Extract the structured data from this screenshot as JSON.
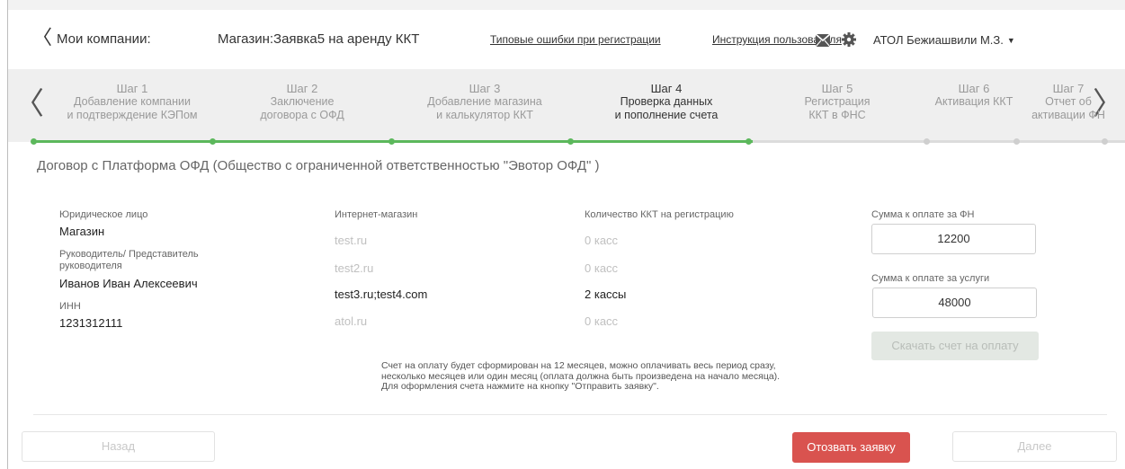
{
  "header": {
    "back_label": "Мои компании:",
    "title": "Магазин:Заявка5 на аренду ККТ",
    "link_errors": "Типовые ошибки при регистрации",
    "link_manual": "Инструкция пользователя",
    "user": "АТОЛ Бежиашвили М.З."
  },
  "steps": [
    {
      "num": "Шаг 1",
      "label1": "Добавление компании",
      "label2": "и подтверждение КЭПом",
      "state": "done"
    },
    {
      "num": "Шаг 2",
      "label1": "Заключение",
      "label2": "договора с ОФД",
      "state": "done"
    },
    {
      "num": "Шаг 3",
      "label1": "Добавление магазина",
      "label2": "и калькулятор ККТ",
      "state": "done"
    },
    {
      "num": "Шаг 4",
      "label1": "Проверка данных",
      "label2": "и пополнение счета",
      "state": "active"
    },
    {
      "num": "Шаг 5",
      "label1": "Регистрация",
      "label2": "ККТ в ФНС",
      "state": "pending"
    },
    {
      "num": "Шаг 6",
      "label1": "Активация ККТ",
      "label2": "",
      "state": "pending"
    },
    {
      "num": "Шаг 7",
      "label1": "Отчет об",
      "label2": "активации ФН",
      "state": "pending"
    }
  ],
  "contract_title": "Договор с Платформа ОФД (Общество с ограниченной ответственностью \"Эвотор ОФД\" )",
  "legal": {
    "entity_label": "Юридическое лицо",
    "entity_value": "Магазин",
    "head_label_1": "Руководитель/ Представитель",
    "head_label_2": "руководителя",
    "head_value": "Иванов Иван Алексеевич",
    "inn_label": "ИНН",
    "inn_value": "1231312111"
  },
  "stores": {
    "store_header": "Интернет-магазин",
    "count_header": "Количество ККТ на регистрацию",
    "rows": [
      {
        "store": "test.ru",
        "count": "0 касс",
        "muted": true
      },
      {
        "store": "test2.ru",
        "count": "0 касс",
        "muted": true
      },
      {
        "store": "test3.ru;test4.com",
        "count": "2 кассы",
        "muted": false
      },
      {
        "store": "atol.ru",
        "count": "0 касс",
        "muted": true
      }
    ]
  },
  "payment": {
    "fn_label": "Сумма к оплате за ФН",
    "fn_value": "12200",
    "services_label": "Сумма к оплате за услуги",
    "services_value": "48000",
    "download_button": "Скачать счет на оплату"
  },
  "note": {
    "line1": "Счет на оплату будет сформирован на 12 месяцев, можно оплачивать весь период сразу,",
    "line2": "несколько месяцев или один месяц (оплата должна быть произведена на начало месяца).",
    "line3": "Для оформления счета нажмите на кнопку \"Отправить заявку\"."
  },
  "footer": {
    "back_button": "Назад",
    "revoke_button": "Отозвать заявку",
    "next_button": "Далее"
  },
  "colors": {
    "accent_green": "#5cb85c",
    "danger_red": "#d9534f"
  }
}
